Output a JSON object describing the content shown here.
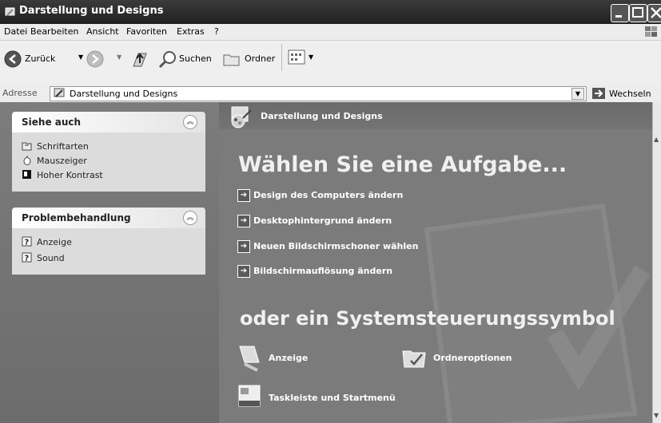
{
  "window": {
    "title": "Darstellung und Designs"
  },
  "menu": {
    "items": [
      "Datei",
      "Bearbeiten",
      "Ansicht",
      "Favoriten",
      "Extras",
      "?"
    ]
  },
  "toolbar": {
    "back_label": "Zurück",
    "search_label": "Suchen",
    "folders_label": "Ordner"
  },
  "address": {
    "label": "Adresse",
    "value": "Darstellung und Designs",
    "go_label": "Wechseln zu"
  },
  "sidebar": {
    "see_also": {
      "title": "Siehe auch",
      "items": [
        "Schriftarten",
        "Mauszeiger",
        "Hoher Kontrast"
      ]
    },
    "troubleshoot": {
      "title": "Problembehandlung",
      "items": [
        "Anzeige",
        "Sound"
      ]
    }
  },
  "main": {
    "header": "Darstellung und Designs",
    "pick_task": "Wählen Sie eine Aufgabe...",
    "tasks": [
      "Design des Computers ändern",
      "Desktophintergrund ändern",
      "Neuen Bildschirmschoner wählen",
      "Bildschirmauflösung ändern"
    ],
    "or_icon": "oder ein Systemsteuerungssymbol",
    "icons": [
      "Anzeige",
      "Ordneroptionen",
      "Taskleiste und Startmenü"
    ]
  }
}
